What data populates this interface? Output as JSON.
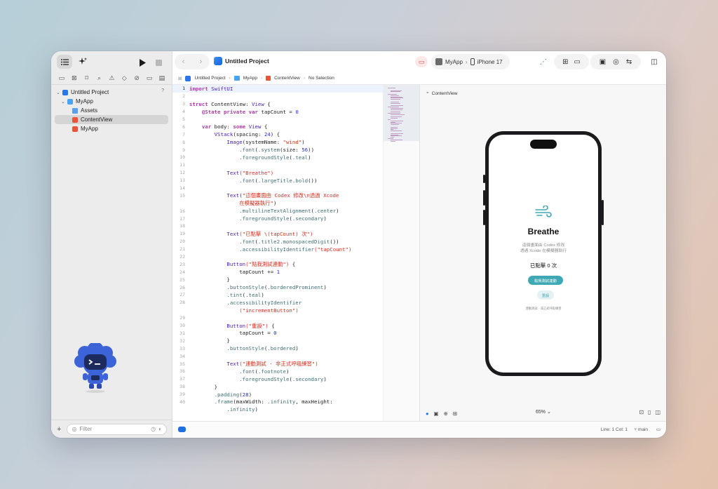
{
  "window": {
    "project_title": "Untitled Project",
    "scheme_app": "MyApp",
    "scheme_device": "iPhone 17"
  },
  "navigator": {
    "items": [
      {
        "label": "Untitled Project",
        "badge": "?"
      },
      {
        "label": "MyApp"
      },
      {
        "label": "Assets"
      },
      {
        "label": "ContentView"
      },
      {
        "label": "MyApp"
      }
    ],
    "filter_placeholder": "Filter"
  },
  "jumpbar": {
    "items": [
      "Untitled Project",
      "MyApp",
      "ContentView",
      "No Selection"
    ]
  },
  "code": {
    "lines": [
      {
        "n": "1",
        "t": "import SwiftUI"
      },
      {
        "n": "2",
        "t": ""
      },
      {
        "n": "3",
        "t": "struct ContentView: View {"
      },
      {
        "n": "4",
        "t": "    @State private var tapCount = 0"
      },
      {
        "n": "5",
        "t": ""
      },
      {
        "n": "6",
        "t": "    var body: some View {"
      },
      {
        "n": "7",
        "t": "        VStack(spacing: 24) {"
      },
      {
        "n": "8",
        "t": "            Image(systemName: \"wind\")"
      },
      {
        "n": "9",
        "t": "                .font(.system(size: 56))"
      },
      {
        "n": "10",
        "t": "                .foregroundStyle(.teal)"
      },
      {
        "n": "11",
        "t": ""
      },
      {
        "n": "12",
        "t": "            Text(\"Breathe\")"
      },
      {
        "n": "13",
        "t": "                .font(.largeTitle.bold())"
      },
      {
        "n": "14",
        "t": ""
      },
      {
        "n": "15",
        "t": "            Text(\"這個畫面由 Codex 修改\\n透過 Xcode"
      },
      {
        "n": "",
        "t": "                在模擬器執行\")"
      },
      {
        "n": "16",
        "t": "                .multilineTextAlignment(.center)"
      },
      {
        "n": "17",
        "t": "                .foregroundStyle(.secondary)"
      },
      {
        "n": "18",
        "t": ""
      },
      {
        "n": "19",
        "t": "            Text(\"已點擊 \\(tapCount) 次\")"
      },
      {
        "n": "20",
        "t": "                .font(.title2.monospacedDigit())"
      },
      {
        "n": "21",
        "t": "                .accessibilityIdentifier(\"tapCount\")"
      },
      {
        "n": "22",
        "t": ""
      },
      {
        "n": "23",
        "t": "            Button(\"點我測試連動\") {"
      },
      {
        "n": "24",
        "t": "                tapCount += 1"
      },
      {
        "n": "25",
        "t": "            }"
      },
      {
        "n": "26",
        "t": "            .buttonStyle(.borderedProminent)"
      },
      {
        "n": "27",
        "t": "            .tint(.teal)"
      },
      {
        "n": "28",
        "t": "            .accessibilityIdentifier"
      },
      {
        "n": "",
        "t": "                (\"incrementButton\")"
      },
      {
        "n": "29",
        "t": ""
      },
      {
        "n": "30",
        "t": "            Button(\"重設\") {"
      },
      {
        "n": "31",
        "t": "                tapCount = 0"
      },
      {
        "n": "32",
        "t": "            }"
      },
      {
        "n": "33",
        "t": "            .buttonStyle(.bordered)"
      },
      {
        "n": "34",
        "t": ""
      },
      {
        "n": "35",
        "t": "            Text(\"連動測試 · 非正式呼吸練習\")"
      },
      {
        "n": "36",
        "t": "                .font(.footnote)"
      },
      {
        "n": "37",
        "t": "                .foregroundStyle(.secondary)"
      },
      {
        "n": "38",
        "t": "        }"
      },
      {
        "n": "39",
        "t": "        .padding(28)"
      },
      {
        "n": "40",
        "t": "        .frame(maxWidth: .infinity, maxHeight:"
      },
      {
        "n": "",
        "t": "            .infinity)"
      }
    ]
  },
  "preview": {
    "label": "ContentView",
    "zoom": "65%",
    "app": {
      "title": "Breathe",
      "subtitle_line1": "這個畫面由 Codex 修改",
      "subtitle_line2": "透過 Xcode 在模擬器執行",
      "count": "已點擊 0 次",
      "primary_button": "點我測試連動",
      "reset_button": "重設",
      "footnote": "連動測試 · 非正式呼吸練習"
    }
  },
  "status": {
    "position": "Line: 1  Col: 1",
    "branch": "main"
  },
  "colors": {
    "accent": "#1f6fe0",
    "teal": "#3ea9b4"
  }
}
